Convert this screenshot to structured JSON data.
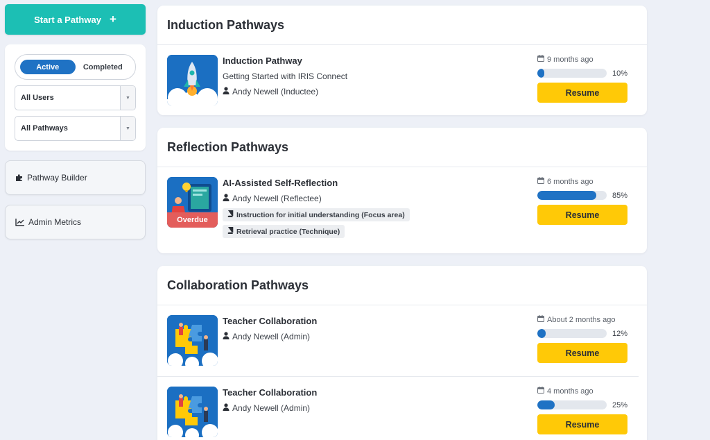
{
  "sidebar": {
    "start_label": "Start a Pathway",
    "start_icon": "plus-icon",
    "toggle": {
      "active_label": "Active",
      "completed_label": "Completed",
      "selected": "Active"
    },
    "users_select": "All Users",
    "pathways_select": "All Pathways",
    "builder_label": "Pathway Builder",
    "metrics_label": "Admin Metrics"
  },
  "colors": {
    "accent_teal": "#1cbfb4",
    "primary_blue": "#1f72c4",
    "resume_yellow": "#ffc907",
    "overdue_red": "#e35d5b"
  },
  "sections": [
    {
      "title": "Induction Pathways",
      "items": [
        {
          "title": "Induction Pathway",
          "subtitle": "Getting Started with IRIS Connect",
          "user": "Andy Newell (Inductee)",
          "date": "9 months ago",
          "progress": 10,
          "progress_label": "10%",
          "button": "Resume",
          "thumb": "rocket"
        }
      ]
    },
    {
      "title": "Reflection Pathways",
      "items": [
        {
          "title": "AI-Assisted Self-Reflection",
          "user": "Andy Newell (Reflectee)",
          "tags": [
            "Instruction for initial understanding (Focus area)",
            "Retrieval practice (Technique)"
          ],
          "overdue": "Overdue",
          "date": "6 months ago",
          "progress": 85,
          "progress_label": "85%",
          "button": "Resume",
          "thumb": "reflection"
        }
      ]
    },
    {
      "title": "Collaboration Pathways",
      "items": [
        {
          "title": "Teacher Collaboration",
          "user": "Andy Newell (Admin)",
          "date": "About 2 months ago",
          "progress": 12,
          "progress_label": "12%",
          "button": "Resume",
          "thumb": "puzzle"
        },
        {
          "title": "Teacher Collaboration",
          "user": "Andy Newell (Admin)",
          "date": "4 months ago",
          "progress": 25,
          "progress_label": "25%",
          "button": "Resume",
          "thumb": "puzzle"
        }
      ]
    }
  ]
}
